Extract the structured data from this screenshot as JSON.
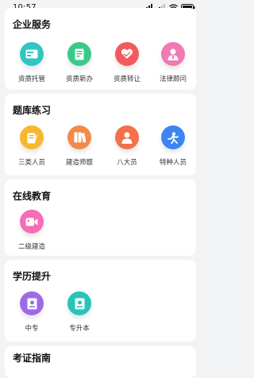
{
  "status": {
    "time": "10:57"
  },
  "sections": [
    {
      "title": "企业服务",
      "items": [
        {
          "label": "资质托管",
          "icon": "card-icon",
          "color": "#2fc6c2"
        },
        {
          "label": "资质新办",
          "icon": "document-icon",
          "color": "#3bc98b"
        },
        {
          "label": "资质转让",
          "icon": "heart-handshake-icon",
          "color": "#f25a5f"
        },
        {
          "label": "法律顾问",
          "icon": "lawyer-icon",
          "color": "#f07ab3"
        }
      ]
    },
    {
      "title": "题库练习",
      "items": [
        {
          "label": "三类人员",
          "icon": "notepad-icon",
          "color": "#f7b72f"
        },
        {
          "label": "建造师题",
          "icon": "books-icon",
          "color": "#f28a4a"
        },
        {
          "label": "八大员",
          "icon": "person-icon",
          "color": "#f2704a"
        },
        {
          "label": "特种人员",
          "icon": "walker-icon",
          "color": "#3d84f2"
        }
      ]
    },
    {
      "title": "在线教育",
      "items": [
        {
          "label": "二级建造",
          "icon": "video-icon",
          "color": "#f56db4"
        }
      ]
    },
    {
      "title": "学历提升",
      "items": [
        {
          "label": "中专",
          "icon": "certificate-icon",
          "color": "#9b6be8"
        },
        {
          "label": "专升本",
          "icon": "diploma-icon",
          "color": "#27c4b8"
        }
      ]
    },
    {
      "title": "考证指南",
      "items": []
    }
  ]
}
